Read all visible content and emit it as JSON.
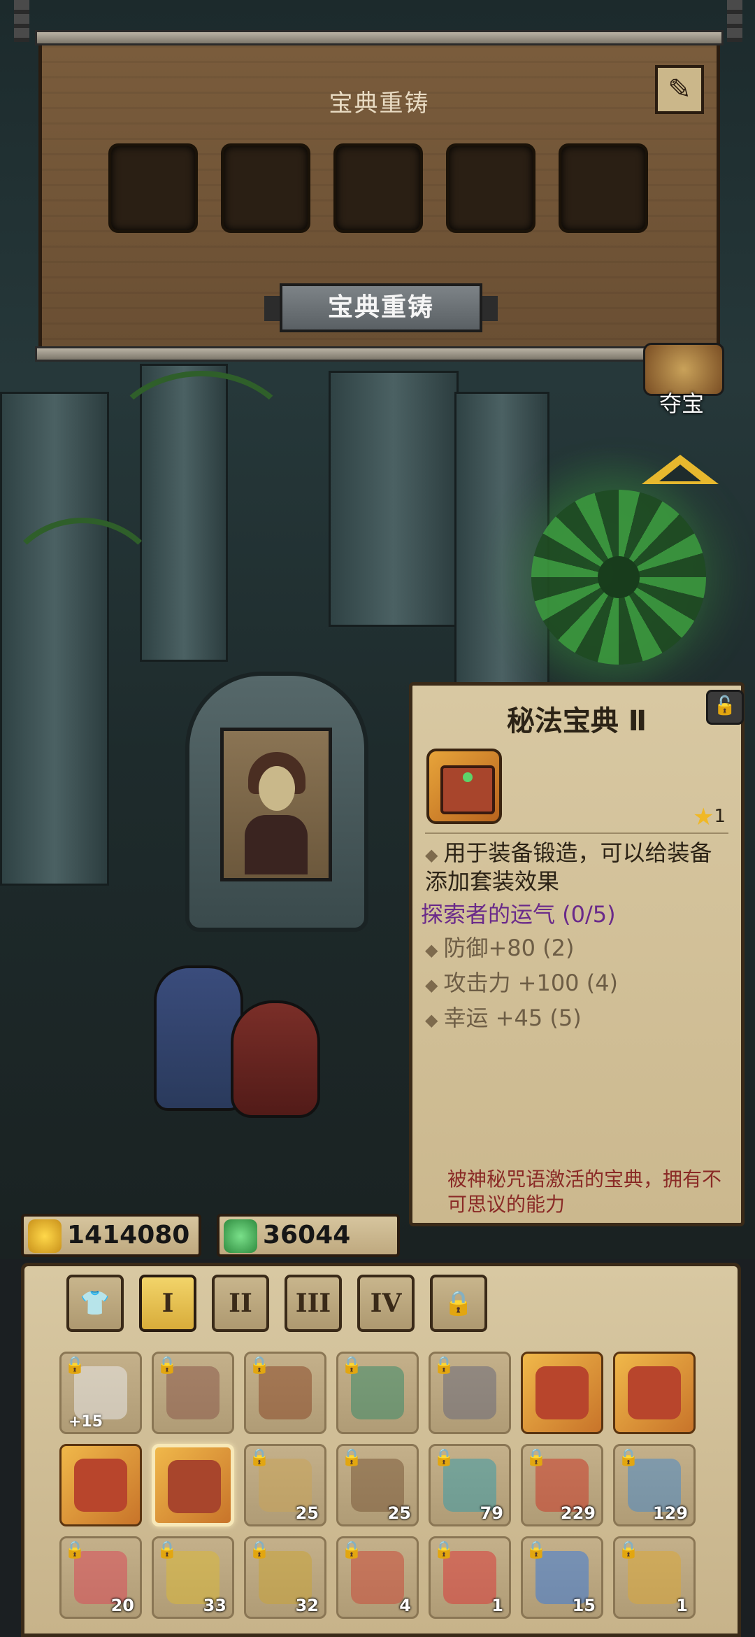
{
  "top_panel": {
    "title": "宝典重铸",
    "reforge_button": "宝典重铸",
    "slots": [
      {},
      {},
      {},
      {},
      {}
    ]
  },
  "side_nav": {
    "treasure_label": "夺宝"
  },
  "detail": {
    "name": "秘法宝典 Ⅱ",
    "star_count": "1",
    "description": "用于装备锻造，可以给装备添加套装效果",
    "set_name": "探索者的运气 (0/5)",
    "stats": [
      "防御+80 (2)",
      "攻击力 +100 (4)",
      "幸运 +45 (5)"
    ],
    "flavor": "被神秘咒语激活的宝典，拥有不可思议的能力"
  },
  "currency": {
    "gold": "1414080",
    "essence": "36044"
  },
  "tabs": [
    "",
    "I",
    "II",
    "III",
    "IV",
    ""
  ],
  "inventory": {
    "rows": [
      [
        {
          "icon": "wings-icon",
          "locked": true,
          "plus": "+15",
          "count": ""
        },
        {
          "icon": "armor-icon",
          "locked": true,
          "count": ""
        },
        {
          "icon": "flame-icon",
          "locked": true,
          "count": ""
        },
        {
          "icon": "coil-icon",
          "locked": true,
          "count": ""
        },
        {
          "icon": "gear-bug-icon",
          "locked": true,
          "count": ""
        },
        {
          "icon": "red-book-icon",
          "locked": false,
          "count": ""
        },
        {
          "icon": "red-book-icon",
          "locked": false,
          "count": ""
        }
      ],
      [
        {
          "icon": "red-book-icon",
          "locked": false,
          "count": ""
        },
        {
          "icon": "green-book-icon",
          "locked": false,
          "count": "",
          "selected": true
        },
        {
          "icon": "scroll-icon",
          "locked": true,
          "count": "25"
        },
        {
          "icon": "pickaxe-icon",
          "locked": true,
          "count": "25"
        },
        {
          "icon": "eye-icon",
          "locked": true,
          "count": "79"
        },
        {
          "icon": "potion-red-icon",
          "locked": true,
          "count": "229"
        },
        {
          "icon": "potion-blue-icon",
          "locked": true,
          "count": "129"
        }
      ],
      [
        {
          "icon": "potion-pink-icon",
          "locked": true,
          "count": "20"
        },
        {
          "icon": "potion-yellow-icon",
          "locked": true,
          "count": "33"
        },
        {
          "icon": "jar-icon",
          "locked": true,
          "count": "32"
        },
        {
          "icon": "crystal-icon",
          "locked": true,
          "count": "4"
        },
        {
          "icon": "shield-red-icon",
          "locked": true,
          "count": "1"
        },
        {
          "icon": "cross-blue-icon",
          "locked": true,
          "count": "15"
        },
        {
          "icon": "cross-gold-icon",
          "locked": true,
          "count": "1"
        }
      ]
    ]
  },
  "colors": {
    "wood": "#7a5c3c",
    "parchment": "#d8c8a2",
    "set_purple": "#6a2a8a",
    "flavor_red": "#8a2a26",
    "active_tab": "#f2d46a"
  }
}
